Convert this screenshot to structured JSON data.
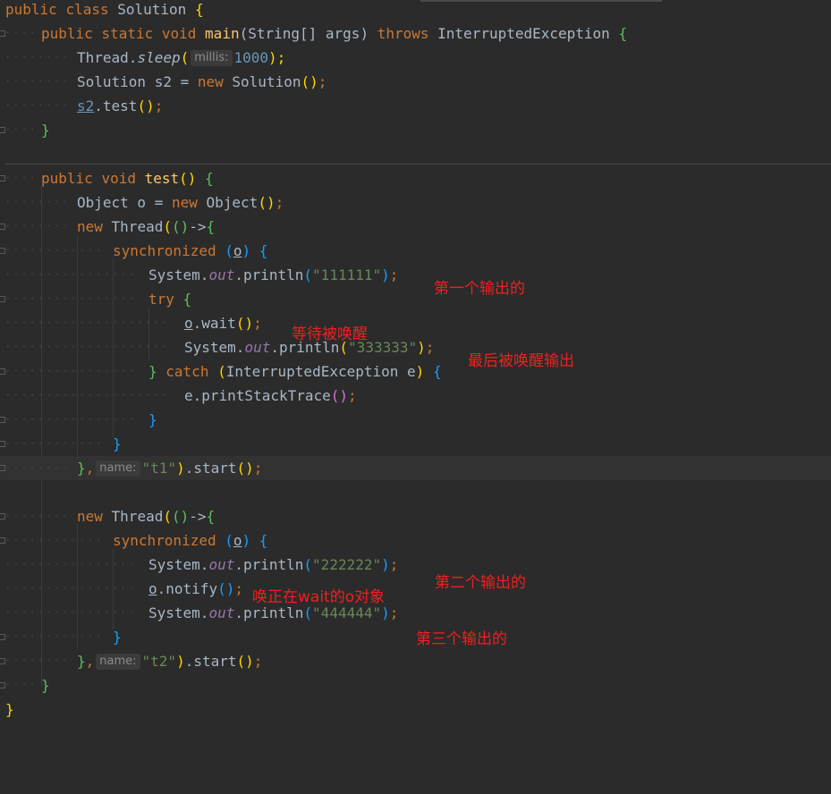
{
  "code": {
    "class_decl": {
      "kw1": "public",
      "kw2": "class",
      "name": "Solution",
      "brace": "{"
    },
    "main_decl": {
      "kw1": "public",
      "kw2": "static",
      "kw3": "void",
      "fn": "main",
      "params": "(String[] args)",
      "throws_kw": "throws",
      "exception": "InterruptedException",
      "brace": "{"
    },
    "sleep_line": {
      "cls": "Thread.",
      "method": "sleep",
      "paren_open": "(",
      "hint": "millis:",
      "value": "1000",
      "paren_close": ");"
    },
    "new_line": {
      "left": "Solution s2 = ",
      "kw": "new",
      "right": " Solution",
      "paren": "()",
      "semi": ";"
    },
    "test_call": {
      "var": "s2",
      "rest": ".test",
      "paren": "()",
      "semi": ";"
    },
    "close_main": "}",
    "test_decl": {
      "kw1": "public",
      "kw2": "void",
      "fn": "test",
      "paren": "()",
      "brace": "{"
    },
    "object_line": {
      "left": "Object o = ",
      "kw": "new",
      "right": " Object",
      "paren": "()",
      "semi": ";"
    },
    "thread1_open": {
      "kw": "new",
      "cls": " Thread",
      "p1": "(",
      "p2": "()",
      "arrow": "->",
      "brace": "{"
    },
    "sync1": {
      "kw": "synchronized",
      "p_open": "(",
      "var": "o",
      "p_close": ")",
      "brace": "{"
    },
    "print1": {
      "sys": "System.",
      "out": "out",
      "call": ".println",
      "p_open": "(",
      "str": "\"111111\"",
      "p_close": ")",
      "semi": ";"
    },
    "try_line": {
      "kw": "try",
      "brace": "{"
    },
    "wait_line": {
      "var": "o",
      "call": ".wait",
      "paren": "()",
      "semi": ";"
    },
    "print3": {
      "sys": "System.",
      "out": "out",
      "call": ".println",
      "p_open": "(",
      "str": "\"333333\"",
      "p_close": ")",
      "semi": ";"
    },
    "catch_line": {
      "brace_close": "}",
      "kw": "catch",
      "p_open": "(",
      "exc": "InterruptedException e",
      "p_close": ")",
      "brace": "{"
    },
    "stack_line": {
      "call": "e.printStackTrace",
      "paren": "()",
      "semi": ";"
    },
    "close_catch": "}",
    "close_sync1": "}",
    "thread1_close": {
      "brace": "}",
      "comma": ",",
      "hint": "name:",
      "str": "\"t1\"",
      "p_close": ")",
      "call": ".start",
      "paren": "()",
      "semi": ";"
    },
    "thread2_open": {
      "kw": "new",
      "cls": " Thread",
      "p1": "(",
      "p2": "()",
      "arrow": "->",
      "brace": "{"
    },
    "sync2": {
      "kw": "synchronized",
      "p_open": "(",
      "var": "o",
      "p_close": ")",
      "brace": "{"
    },
    "print2": {
      "sys": "System.",
      "out": "out",
      "call": ".println",
      "p_open": "(",
      "str": "\"222222\"",
      "p_close": ")",
      "semi": ";"
    },
    "notify_line": {
      "var": "o",
      "call": ".notify",
      "paren": "()",
      "semi": ";"
    },
    "print4": {
      "sys": "System.",
      "out": "out",
      "call": ".println",
      "p_open": "(",
      "str": "\"444444\"",
      "p_close": ")",
      "semi": ";"
    },
    "close_sync2": "}",
    "thread2_close": {
      "brace": "}",
      "comma": ",",
      "hint": "name:",
      "str": "\"t2\"",
      "p_close": ")",
      "call": ".start",
      "paren": "()",
      "semi": ";"
    },
    "close_test": "}",
    "close_class": "}"
  },
  "annotations": {
    "first_output": "第一个输出的",
    "waiting": "等待被唤醒",
    "last_output": "最后被唤醒输出",
    "second_output": "第二个输出的",
    "notify_note": "唤正在wait的o对象",
    "third_output": "第三个输出的"
  },
  "colors": {
    "background": "#2b2b2b",
    "keyword": "#cc7832",
    "method": "#ffc66d",
    "string": "#6a8759",
    "number": "#6897bb",
    "field": "#9876aa",
    "annotation": "#f02020"
  }
}
